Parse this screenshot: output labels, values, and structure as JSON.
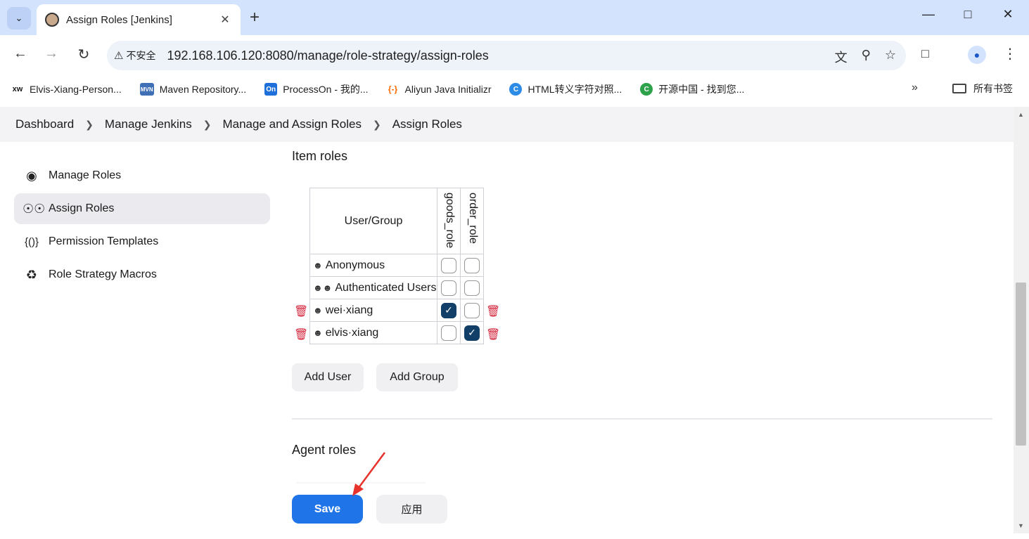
{
  "browser": {
    "tab_title": "Assign Roles [Jenkins]",
    "security_label": "不安全",
    "url": "192.168.106.120:8080/manage/role-strategy/assign-roles",
    "bookmarks": [
      {
        "icon_text": "xw",
        "label": "Elvis-Xiang-Person...",
        "color": "#1a1a1a"
      },
      {
        "icon_text": "MVN",
        "label": "Maven Repository...",
        "color": "#3f6fb5"
      },
      {
        "icon_text": "On",
        "label": "ProcessOn - 我的...",
        "color": "#1e6fd9"
      },
      {
        "icon_text": "{-}",
        "label": "Aliyun Java Initializr",
        "color": "#ff6a00"
      },
      {
        "icon_text": "C",
        "label": "HTML转义字符对照...",
        "color": "#2b8be6"
      },
      {
        "icon_text": "C",
        "label": "开源中国 - 找到您...",
        "color": "#2ea24a"
      }
    ],
    "all_bookmarks": "所有书签"
  },
  "breadcrumbs": [
    "Dashboard",
    "Manage Jenkins",
    "Manage and Assign Roles",
    "Assign Roles"
  ],
  "sidebar": {
    "items": [
      {
        "label": "Manage Roles",
        "icon": "fingerprint-icon"
      },
      {
        "label": "Assign Roles",
        "icon": "people-icon",
        "active": true
      },
      {
        "label": "Permission Templates",
        "icon": "braces-icon"
      },
      {
        "label": "Role Strategy Macros",
        "icon": "puzzle-icon"
      }
    ]
  },
  "item_roles": {
    "title": "Item roles",
    "header": "User/Group",
    "roles": [
      "goods_role",
      "order_role"
    ],
    "rows": [
      {
        "name": "Anonymous",
        "type": "user",
        "checks": [
          false,
          false
        ],
        "deletable": false
      },
      {
        "name": "Authenticated Users",
        "type": "group",
        "checks": [
          false,
          false
        ],
        "deletable": false
      },
      {
        "name": "wei·xiang",
        "type": "user",
        "checks": [
          true,
          false
        ],
        "deletable": true
      },
      {
        "name": "elvis·xiang",
        "type": "user",
        "checks": [
          false,
          true
        ],
        "deletable": true
      }
    ],
    "add_user": "Add User",
    "add_group": "Add Group"
  },
  "agent_roles": {
    "title": "Agent roles"
  },
  "actions": {
    "save": "Save",
    "apply": "应用"
  },
  "colors": {
    "accent": "#1f74e8",
    "checkbox": "#113f67",
    "delete": "#d4243b",
    "annotation_arrow": "#e8322c"
  }
}
